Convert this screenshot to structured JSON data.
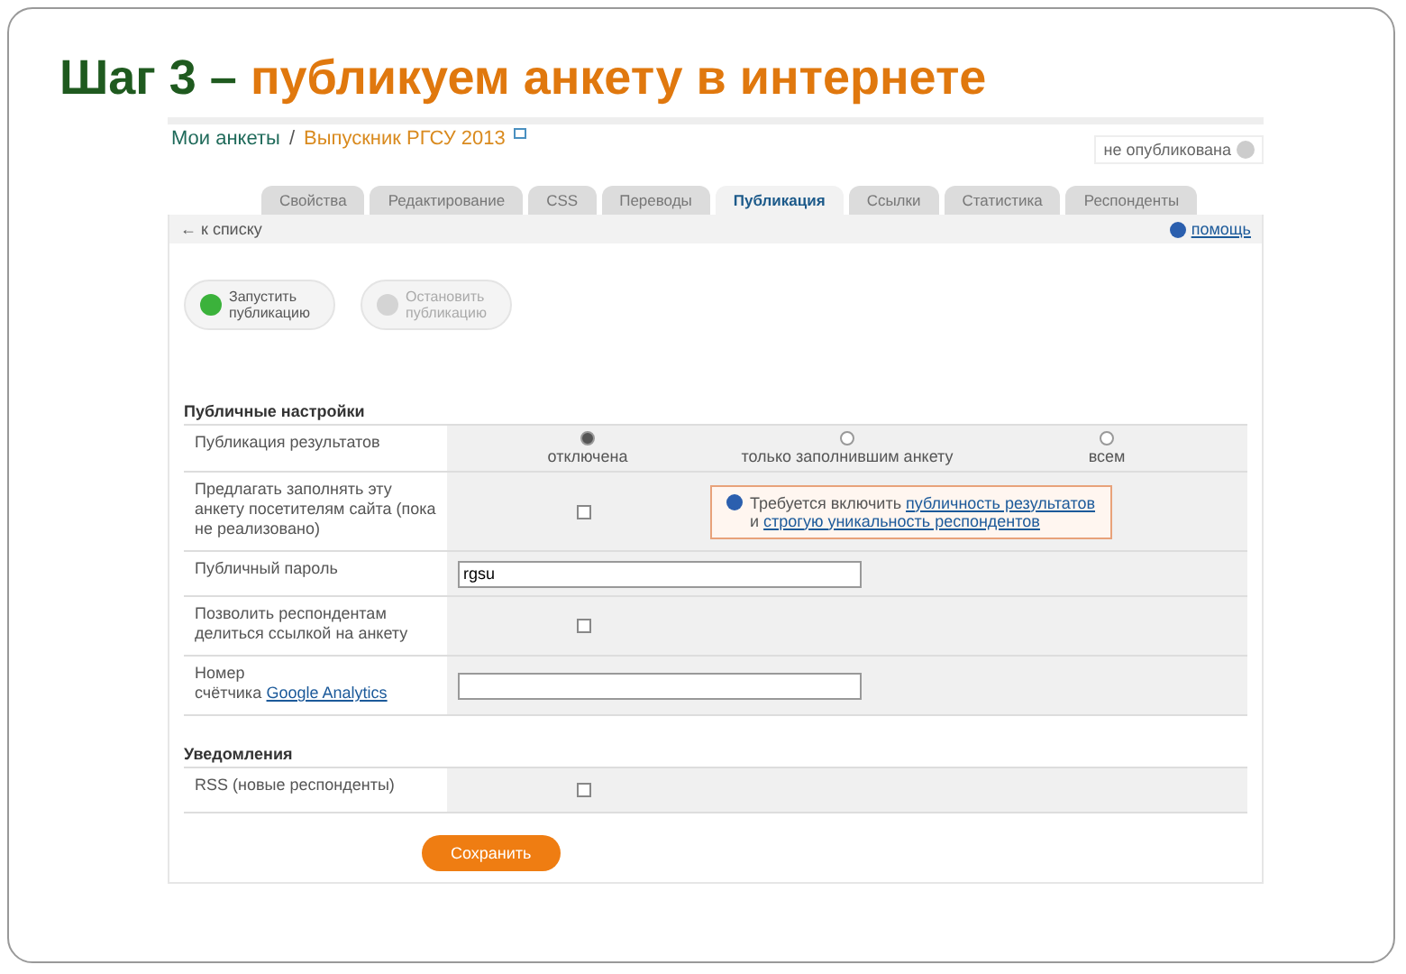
{
  "slide_title": {
    "lead": "Шаг  3 –",
    "rest": "публикуем анкету в интернете"
  },
  "breadcrumb": {
    "root": "Мои анкеты",
    "separator": "/",
    "current": "Выпускник РГСУ 2013"
  },
  "status": {
    "label": "не опубликована",
    "published": false
  },
  "tabs": [
    {
      "label": "Свойства",
      "selected": false
    },
    {
      "label": "Редактирование",
      "selected": false
    },
    {
      "label": "CSS",
      "selected": false
    },
    {
      "label": "Переводы",
      "selected": false
    },
    {
      "label": "Публикация",
      "selected": true
    },
    {
      "label": "Ссылки",
      "selected": false
    },
    {
      "label": "Статистика",
      "selected": false
    },
    {
      "label": "Респонденты",
      "selected": false
    }
  ],
  "back_link": "← к списку",
  "help_link": "помощь",
  "actions": [
    {
      "label": "Запустить публикацию",
      "disabled": false
    },
    {
      "label": "Остановить публикацию",
      "disabled": true
    }
  ],
  "public_section": {
    "title": "Публичные настройки",
    "rows": [
      {
        "kind": "radio",
        "label": "Публикация результатов",
        "options": [
          {
            "label": "отключена",
            "selected": true
          },
          {
            "label": "только заполнившим анкету",
            "selected": false
          },
          {
            "label": "всем",
            "selected": false
          }
        ]
      },
      {
        "kind": "checkbox",
        "label": "Предлагать заполнять эту анкету посетителям сайта (пока не реализовано)",
        "checked": false,
        "notice": {
          "text": "Требуется включить",
          "link1": "публичность результатов",
          "middle": "и",
          "link2": "строгую уникальность респондентов"
        }
      },
      {
        "kind": "input",
        "label": "Публичный пароль",
        "value": "rgsu"
      },
      {
        "kind": "checkbox",
        "label": "Позволить респондентам делиться ссылкой на анкету",
        "checked": false
      },
      {
        "kind": "input",
        "label": "Номер счётчика",
        "label_link": "Google Analytics",
        "value": ""
      }
    ]
  },
  "notify_section": {
    "title": "Уведомления",
    "rows": [
      {
        "kind": "checkbox",
        "label": "RSS (новые респонденты)",
        "checked": false
      }
    ]
  },
  "save_button": "Сохранить"
}
